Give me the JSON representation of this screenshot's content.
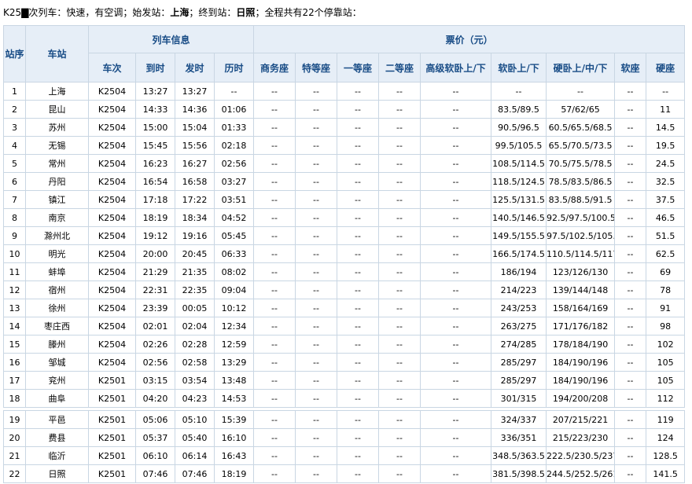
{
  "header": {
    "part1": "K25▇次列车：快速，有空调",
    "part2": "；始发站：",
    "origin": "上海",
    "part3": "；终到站：",
    "terminus": "日照",
    "part4": "；全程共有22个停靠站："
  },
  "table": {
    "col_station_no": "站序",
    "col_station": "车站",
    "group_train_info": "列车信息",
    "group_fare": "票价（元）",
    "sub_columns": [
      "车次",
      "到时",
      "发时",
      "历时",
      "商务座",
      "特等座",
      "一等座",
      "二等座",
      "高级软卧上/下",
      "软卧上/下",
      "硬卧上/中/下",
      "软座",
      "硬座"
    ],
    "rows": [
      [
        "1",
        "上海",
        "K2504",
        "13:27",
        "13:27",
        "--",
        "--",
        "--",
        "--",
        "--",
        "--",
        "--",
        "--",
        "--",
        "--"
      ],
      [
        "2",
        "昆山",
        "K2504",
        "14:33",
        "14:36",
        "01:06",
        "--",
        "--",
        "--",
        "--",
        "--",
        "83.5/89.5",
        "57/62/65",
        "--",
        "11"
      ],
      [
        "3",
        "苏州",
        "K2504",
        "15:00",
        "15:04",
        "01:33",
        "--",
        "--",
        "--",
        "--",
        "--",
        "90.5/96.5",
        "60.5/65.5/68.5",
        "--",
        "14.5"
      ],
      [
        "4",
        "无锡",
        "K2504",
        "15:45",
        "15:56",
        "02:18",
        "--",
        "--",
        "--",
        "--",
        "--",
        "99.5/105.5",
        "65.5/70.5/73.5",
        "--",
        "19.5"
      ],
      [
        "5",
        "常州",
        "K2504",
        "16:23",
        "16:27",
        "02:56",
        "--",
        "--",
        "--",
        "--",
        "--",
        "108.5/114.5",
        "70.5/75.5/78.5",
        "--",
        "24.5"
      ],
      [
        "6",
        "丹阳",
        "K2504",
        "16:54",
        "16:58",
        "03:27",
        "--",
        "--",
        "--",
        "--",
        "--",
        "118.5/124.5",
        "78.5/83.5/86.5",
        "--",
        "32.5"
      ],
      [
        "7",
        "镇江",
        "K2504",
        "17:18",
        "17:22",
        "03:51",
        "--",
        "--",
        "--",
        "--",
        "--",
        "125.5/131.5",
        "83.5/88.5/91.5",
        "--",
        "37.5"
      ],
      [
        "8",
        "南京",
        "K2504",
        "18:19",
        "18:34",
        "04:52",
        "--",
        "--",
        "--",
        "--",
        "--",
        "140.5/146.5",
        "92.5/97.5/100.5",
        "--",
        "46.5"
      ],
      [
        "9",
        "滁州北",
        "K2504",
        "19:12",
        "19:16",
        "05:45",
        "--",
        "--",
        "--",
        "--",
        "--",
        "149.5/155.5",
        "97.5/102.5/105.5",
        "--",
        "51.5"
      ],
      [
        "10",
        "明光",
        "K2504",
        "20:00",
        "20:45",
        "06:33",
        "--",
        "--",
        "--",
        "--",
        "--",
        "166.5/174.5",
        "110.5/114.5/117.5",
        "--",
        "62.5"
      ],
      [
        "11",
        "蚌埠",
        "K2504",
        "21:29",
        "21:35",
        "08:02",
        "--",
        "--",
        "--",
        "--",
        "--",
        "186/194",
        "123/126/130",
        "--",
        "69"
      ],
      [
        "12",
        "宿州",
        "K2504",
        "22:31",
        "22:35",
        "09:04",
        "--",
        "--",
        "--",
        "--",
        "--",
        "214/223",
        "139/144/148",
        "--",
        "78"
      ],
      [
        "13",
        "徐州",
        "K2504",
        "23:39",
        "00:05",
        "10:12",
        "--",
        "--",
        "--",
        "--",
        "--",
        "243/253",
        "158/164/169",
        "--",
        "91"
      ],
      [
        "14",
        "枣庄西",
        "K2504",
        "02:01",
        "02:04",
        "12:34",
        "--",
        "--",
        "--",
        "--",
        "--",
        "263/275",
        "171/176/182",
        "--",
        "98"
      ],
      [
        "15",
        "滕州",
        "K2504",
        "02:26",
        "02:28",
        "12:59",
        "--",
        "--",
        "--",
        "--",
        "--",
        "274/285",
        "178/184/190",
        "--",
        "102"
      ],
      [
        "16",
        "邹城",
        "K2504",
        "02:56",
        "02:58",
        "13:29",
        "--",
        "--",
        "--",
        "--",
        "--",
        "285/297",
        "184/190/196",
        "--",
        "105"
      ],
      [
        "17",
        "兖州",
        "K2501",
        "03:15",
        "03:54",
        "13:48",
        "--",
        "--",
        "--",
        "--",
        "--",
        "285/297",
        "184/190/196",
        "--",
        "105"
      ],
      [
        "18",
        "曲阜",
        "K2501",
        "04:20",
        "04:23",
        "14:53",
        "--",
        "--",
        "--",
        "--",
        "--",
        "301/315",
        "194/200/208",
        "--",
        "112"
      ]
    ],
    "rows2": [
      [
        "19",
        "平邑",
        "K2501",
        "05:06",
        "05:10",
        "15:39",
        "--",
        "--",
        "--",
        "--",
        "--",
        "324/337",
        "207/215/221",
        "--",
        "119"
      ],
      [
        "20",
        "费县",
        "K2501",
        "05:37",
        "05:40",
        "16:10",
        "--",
        "--",
        "--",
        "--",
        "--",
        "336/351",
        "215/223/230",
        "--",
        "124"
      ],
      [
        "21",
        "临沂",
        "K2501",
        "06:10",
        "06:14",
        "16:43",
        "--",
        "--",
        "--",
        "--",
        "--",
        "348.5/363.5",
        "222.5/230.5/237.5",
        "--",
        "128.5"
      ],
      [
        "22",
        "日照",
        "K2501",
        "07:46",
        "07:46",
        "18:19",
        "--",
        "--",
        "--",
        "--",
        "--",
        "381.5/398.5",
        "244.5/252.5/261.5",
        "--",
        "141.5"
      ]
    ]
  }
}
